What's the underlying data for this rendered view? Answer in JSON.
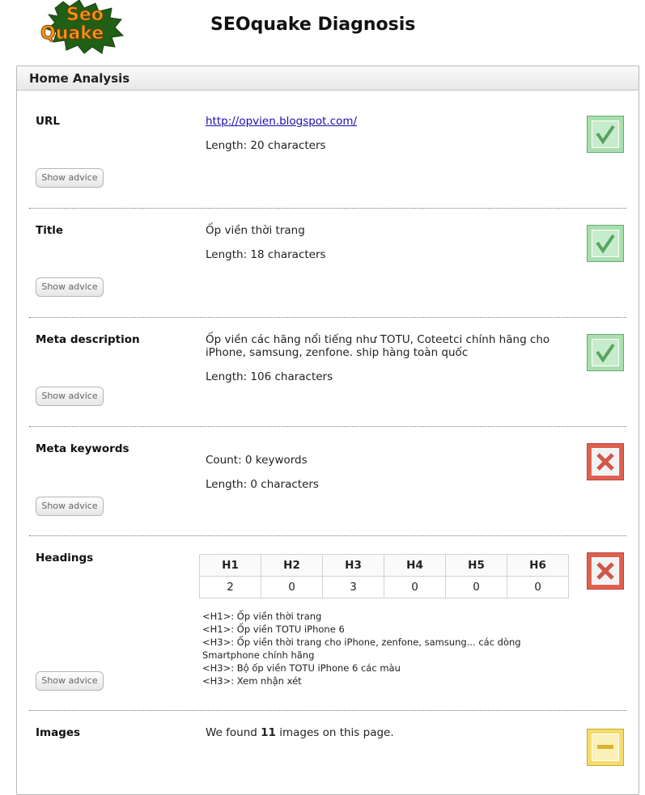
{
  "header": {
    "logo_text_line1": "Seo",
    "logo_text_line2": "Quake",
    "title": "SEOquake Diagnosis"
  },
  "panel": {
    "title": "Home Analysis"
  },
  "advice_label": "Show advice",
  "sections": {
    "url": {
      "label": "URL",
      "link": "http://opvien.blogspot.com/",
      "length": "Length: 20 characters",
      "status": "pass"
    },
    "title": {
      "label": "Title",
      "value": "Ốp viền thời trang",
      "length": "Length: 18 characters",
      "status": "pass"
    },
    "meta_description": {
      "label": "Meta description",
      "value": "Ốp viền các hãng nổi tiếng như TOTU, Coteetci chính hãng cho iPhone, samsung, zenfone. ship hàng toàn quốc",
      "length": "Length: 106 characters",
      "status": "pass"
    },
    "meta_keywords": {
      "label": "Meta keywords",
      "count": "Count: 0 keywords",
      "length": "Length: 0 characters",
      "status": "fail"
    },
    "headings": {
      "label": "Headings",
      "columns": [
        "H1",
        "H2",
        "H3",
        "H4",
        "H5",
        "H6"
      ],
      "counts": [
        "2",
        "0",
        "3",
        "0",
        "0",
        "0"
      ],
      "list": [
        "<H1>: Ốp viền thời trang",
        "<H1>: Ốp viền TOTU iPhone 6",
        "<H3>: Ốp viền thời trang cho iPhone, zenfone, samsung... các dòng Smartphone chính hãng",
        "<H3>: Bộ ốp viền TOTU iPhone 6 các màu",
        "<H3>: Xem nhận xét"
      ],
      "status": "fail"
    },
    "images": {
      "label": "Images",
      "text_before": "We found ",
      "count": "11",
      "text_after": " images on this page.",
      "status": "warning"
    }
  },
  "colors": {
    "pass_fill": "#a8dfae",
    "fail_fill": "#e06050",
    "warning_fill": "#f4dc6a",
    "link": "#1a0dab"
  }
}
